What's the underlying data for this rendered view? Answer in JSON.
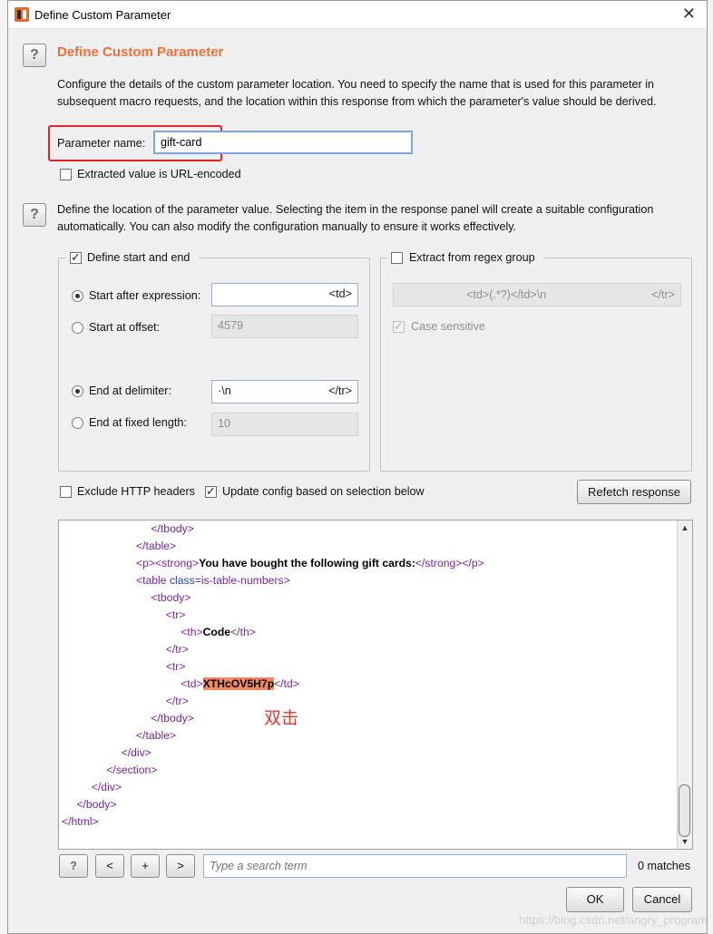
{
  "window": {
    "title": "Define Custom Parameter",
    "close_glyph": "✕"
  },
  "section1": {
    "heading": "Define Custom Parameter",
    "description_line1": "Configure the details of the custom parameter location. You need to specify the name that is used for this parameter in",
    "description_line2": "subsequent macro requests, and the location within this response from which the parameter's value should be derived.",
    "param_name_label": "Parameter name:",
    "param_name_value": "gift-card",
    "url_encoded_label": "Extracted value is URL-encoded",
    "url_encoded_checked": false
  },
  "section2": {
    "description_line1": "Define the location of the parameter value. Selecting the item in the response panel will create a suitable configuration",
    "description_line2": "automatically. You can also modify the configuration manually to ensure it works effectively."
  },
  "start_end": {
    "title": "Define start and end",
    "checked": true,
    "start_after_label": "Start after expression:",
    "start_after_value": "<td>",
    "start_offset_label": "Start at offset:",
    "start_offset_value": "4579",
    "end_delim_label": "End at delimiter:",
    "end_delim_value_left": "·\\n",
    "end_delim_value_right": "</tr>",
    "end_fixed_label": "End at fixed length:",
    "end_fixed_value": "10",
    "selected_start": "start_after",
    "selected_end": "end_delimiter"
  },
  "regex": {
    "title": "Extract from regex group",
    "checked": false,
    "expr_left": "<td>(.*?)</td>\\n",
    "expr_right": "</tr>",
    "case_sensitive_label": "Case sensitive",
    "case_sensitive_checked": true
  },
  "options": {
    "exclude_headers_label": "Exclude HTTP headers",
    "exclude_headers_checked": false,
    "update_config_label": "Update config based on selection below",
    "update_config_checked": true,
    "refetch_label": "Refetch response"
  },
  "response_lines": [
    {
      "indent": 6,
      "parts": [
        [
          "tag",
          "</"
        ],
        [
          "tag",
          "tbody"
        ],
        [
          "tag",
          ">"
        ]
      ]
    },
    {
      "indent": 5,
      "parts": [
        [
          "tag",
          "</table>"
        ]
      ]
    },
    {
      "indent": 5,
      "parts": [
        [
          "tag",
          "<p><strong>"
        ],
        [
          "txt",
          "You have bought the following gift cards:"
        ],
        [
          "tag",
          "</strong></p>"
        ]
      ]
    },
    {
      "indent": 5,
      "parts": [
        [
          "tag",
          "<table "
        ],
        [
          "attr",
          "class"
        ],
        [
          "tag",
          "=is-table-numbers>"
        ]
      ]
    },
    {
      "indent": 6,
      "parts": [
        [
          "tag",
          "<tbody>"
        ]
      ]
    },
    {
      "indent": 7,
      "parts": [
        [
          "tag",
          "<tr>"
        ]
      ]
    },
    {
      "indent": 8,
      "parts": [
        [
          "tag",
          "<th>"
        ],
        [
          "txt",
          "Code"
        ],
        [
          "tag",
          "</th>"
        ]
      ]
    },
    {
      "indent": 7,
      "parts": [
        [
          "tag",
          "</tr>"
        ]
      ]
    },
    {
      "indent": 7,
      "parts": [
        [
          "tag",
          "<tr>"
        ]
      ]
    },
    {
      "indent": 8,
      "parts": [
        [
          "tag",
          "<td>"
        ],
        [
          "hl",
          "XTHcOV5H7p"
        ],
        [
          "tag",
          "</td>"
        ]
      ]
    },
    {
      "indent": 7,
      "parts": [
        [
          "tag",
          "</tr>"
        ]
      ]
    },
    {
      "indent": 6,
      "parts": [
        [
          "tag",
          "</tbody>"
        ]
      ]
    },
    {
      "indent": 5,
      "parts": [
        [
          "tag",
          "</table>"
        ]
      ]
    },
    {
      "indent": 4,
      "parts": [
        [
          "tag",
          "</div>"
        ]
      ]
    },
    {
      "indent": 3,
      "parts": [
        [
          "tag",
          "</section>"
        ]
      ]
    },
    {
      "indent": 2,
      "parts": [
        [
          "tag",
          "</div>"
        ]
      ]
    },
    {
      "indent": 1,
      "parts": [
        [
          "tag",
          "</body>"
        ]
      ]
    },
    {
      "indent": 0,
      "parts": [
        [
          "tag",
          "</html>"
        ]
      ]
    }
  ],
  "annotation": "双击",
  "search": {
    "help_label": "?",
    "prev_label": "<",
    "add_label": "+",
    "next_label": ">",
    "placeholder": "Type a search term",
    "matches": "0 matches"
  },
  "footer": {
    "ok_label": "OK",
    "cancel_label": "Cancel"
  },
  "watermark": "https://blog.csdn.net/angry_program",
  "colors": {
    "accent": "#e8703a",
    "highlight": "#f4895b",
    "annotation_box": "#e32222"
  }
}
